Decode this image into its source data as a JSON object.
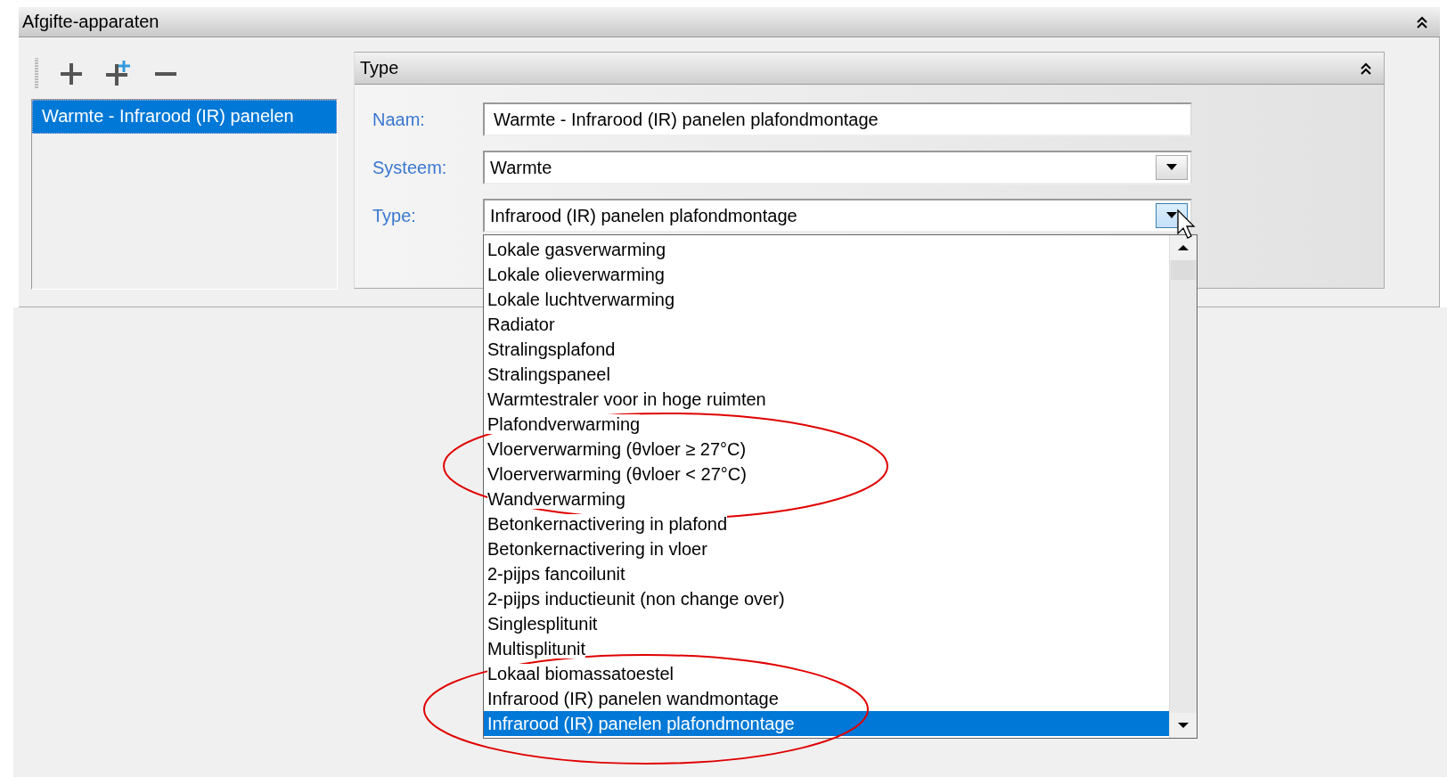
{
  "panel": {
    "title": "Afgifte-apparaten"
  },
  "list": {
    "items": [
      {
        "label": "Warmte - Infrarood (IR) panelen",
        "selected": true
      }
    ]
  },
  "group": {
    "title": "Type",
    "fields": [
      {
        "label": "Naam:",
        "value": "Warmte - Infrarood (IR) panelen plafondmontage",
        "kind": "text"
      },
      {
        "label": "Systeem:",
        "value": "Warmte",
        "kind": "combo"
      },
      {
        "label": "Type:",
        "value": "Infrarood (IR) panelen plafondmontage",
        "kind": "combo",
        "expanded": true
      }
    ]
  },
  "dropdown": {
    "options": [
      {
        "label": "Lokale gasverwarming",
        "selected": false
      },
      {
        "label": "Lokale olieverwarming",
        "selected": false
      },
      {
        "label": "Lokale luchtverwarming",
        "selected": false
      },
      {
        "label": "Radiator",
        "selected": false
      },
      {
        "label": "Stralingsplafond",
        "selected": false
      },
      {
        "label": "Stralingspaneel",
        "selected": false
      },
      {
        "label": "Warmtestraler voor in hoge ruimten",
        "selected": false
      },
      {
        "label": "Plafondverwarming",
        "selected": false
      },
      {
        "label": "Vloerverwarming (θvloer ≥ 27°C)",
        "selected": false
      },
      {
        "label": "Vloerverwarming (θvloer < 27°C)",
        "selected": false
      },
      {
        "label": "Wandverwarming",
        "selected": false
      },
      {
        "label": "Betonkernactivering in plafond",
        "selected": false
      },
      {
        "label": "Betonkernactivering in vloer",
        "selected": false
      },
      {
        "label": "2-pijps fancoilunit",
        "selected": false
      },
      {
        "label": "2-pijps inductieunit (non change over)",
        "selected": false
      },
      {
        "label": "Singlesplitunit",
        "selected": false
      },
      {
        "label": "Multisplitunit",
        "selected": false
      },
      {
        "label": "Lokaal biomassatoestel",
        "selected": false
      },
      {
        "label": "Infrarood (IR) panelen wandmontage",
        "selected": false
      },
      {
        "label": "Infrarood (IR) panelen plafondmontage",
        "selected": true
      }
    ]
  }
}
